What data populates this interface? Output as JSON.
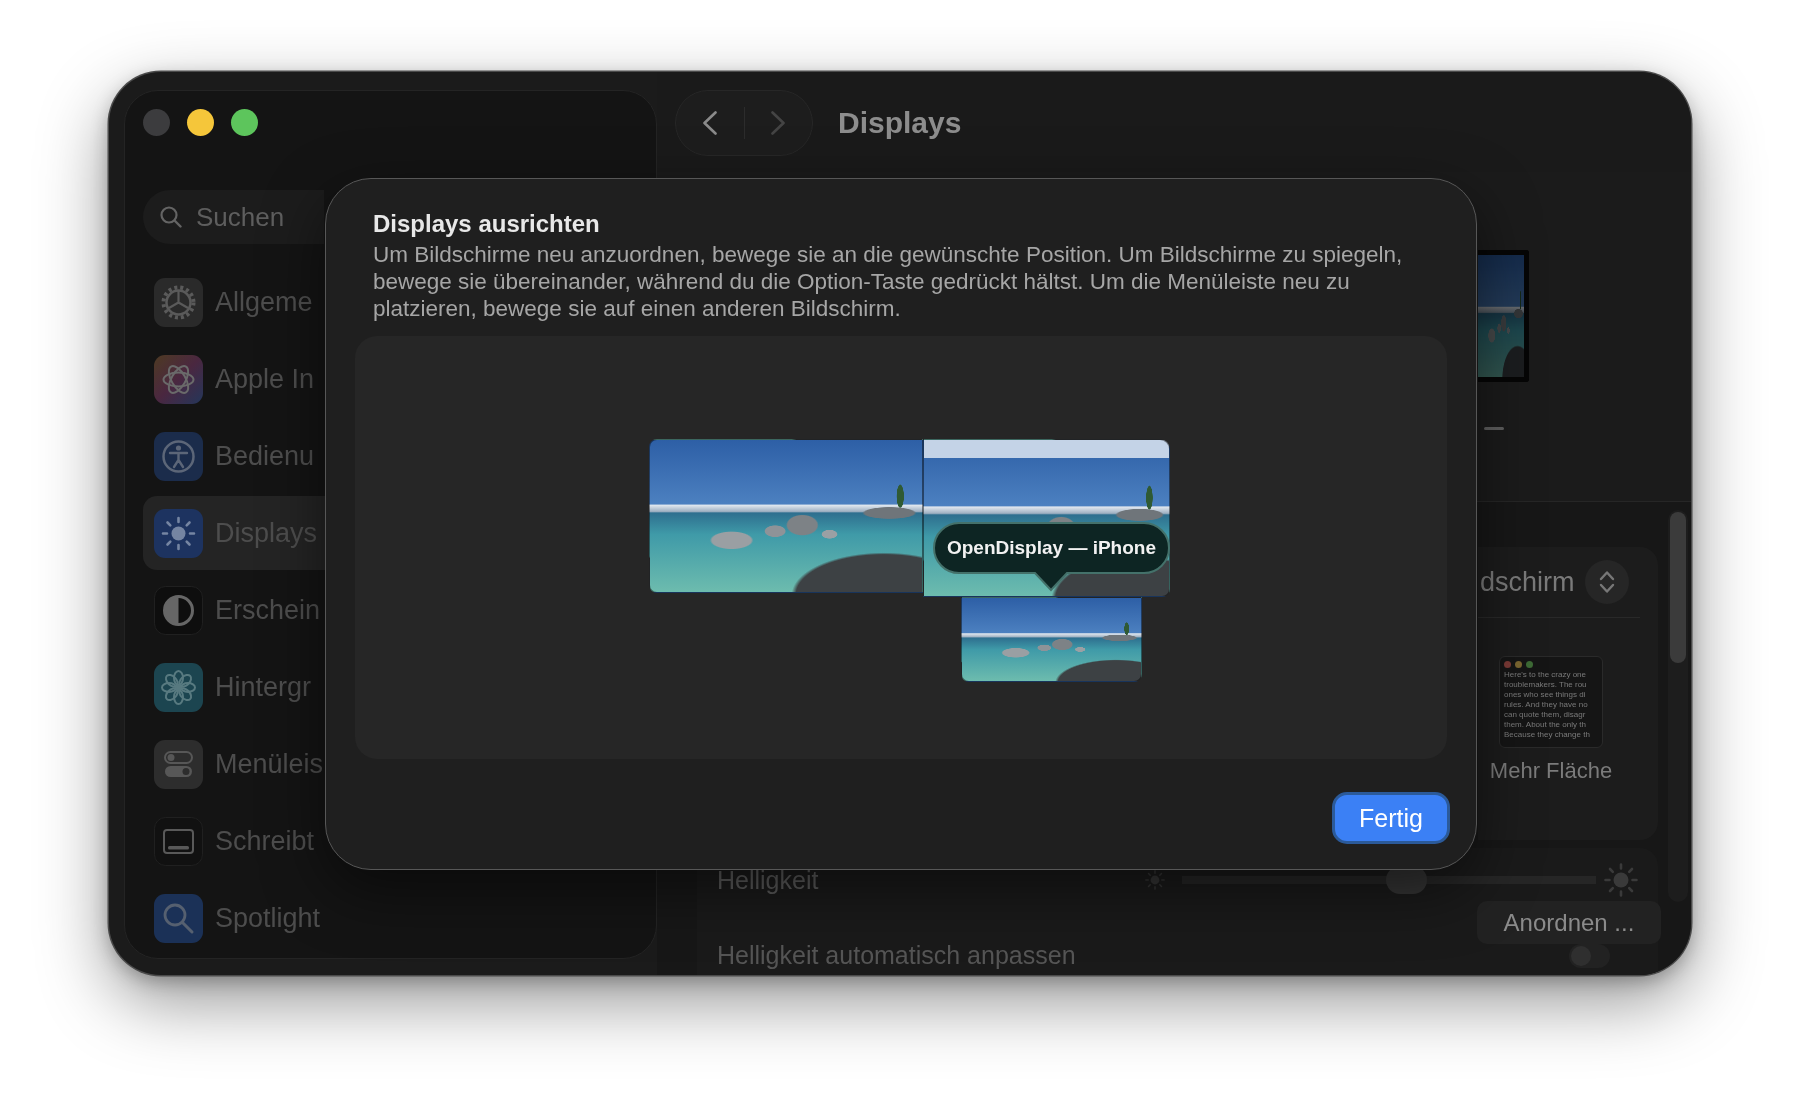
{
  "window_controls": [
    {
      "kind": "close",
      "disabled": true
    },
    {
      "kind": "minimize",
      "disabled": false
    },
    {
      "kind": "zoom",
      "disabled": false
    }
  ],
  "sidebar": {
    "search": {
      "placeholder": "Suchen"
    },
    "items": [
      {
        "label": "Allgeme",
        "selected": false
      },
      {
        "label": "Apple In",
        "selected": false
      },
      {
        "label": "Bedienu",
        "selected": false
      },
      {
        "label": "Displays",
        "selected": true
      },
      {
        "label": "Erschein",
        "selected": false
      },
      {
        "label": "Hintergr",
        "selected": false
      },
      {
        "label": "Menüleis",
        "selected": false
      },
      {
        "label": "Schreibt",
        "selected": false
      },
      {
        "label": "Spotlight",
        "selected": false
      }
    ]
  },
  "toolbar": {
    "back": {
      "disabled": false
    },
    "forward": {
      "disabled": true
    },
    "title": "Displays"
  },
  "display_settings": {
    "resolution": {
      "label": "dschirm",
      "options": [
        {
          "label": "Mehr Fläche",
          "preview_lines": [
            "Here's to the crazy one",
            "troublemakers. The rou",
            "ones who see things di",
            "rules. And they have no",
            "can quote them, disagr",
            "them. About the only th",
            "Because they change th"
          ]
        }
      ]
    },
    "brightness": {
      "label": "Helligkeit",
      "level": 0.54
    },
    "auto_brightness": {
      "label": "Helligkeit automatisch anpassen",
      "on": false
    },
    "arrange_button": "Anordnen ..."
  },
  "sheet": {
    "title": "Displays ausrichten",
    "description": "Um Bildschirme neu anzuordnen, bewege sie an die gewünschte Position. Um Bildschirme zu spiegeln, bewege sie übereinander, während du die Option-Taste gedrückt hältst. Um die Menüleiste neu zu platzieren, bewege sie auf einen anderen Bildschirm.",
    "displays": [
      {
        "menu_bar": false
      },
      {
        "menu_bar": true
      },
      {
        "menu_bar": false
      }
    ],
    "tooltip": "OpenDisplay — iPhone",
    "done_button": "Fertig"
  }
}
